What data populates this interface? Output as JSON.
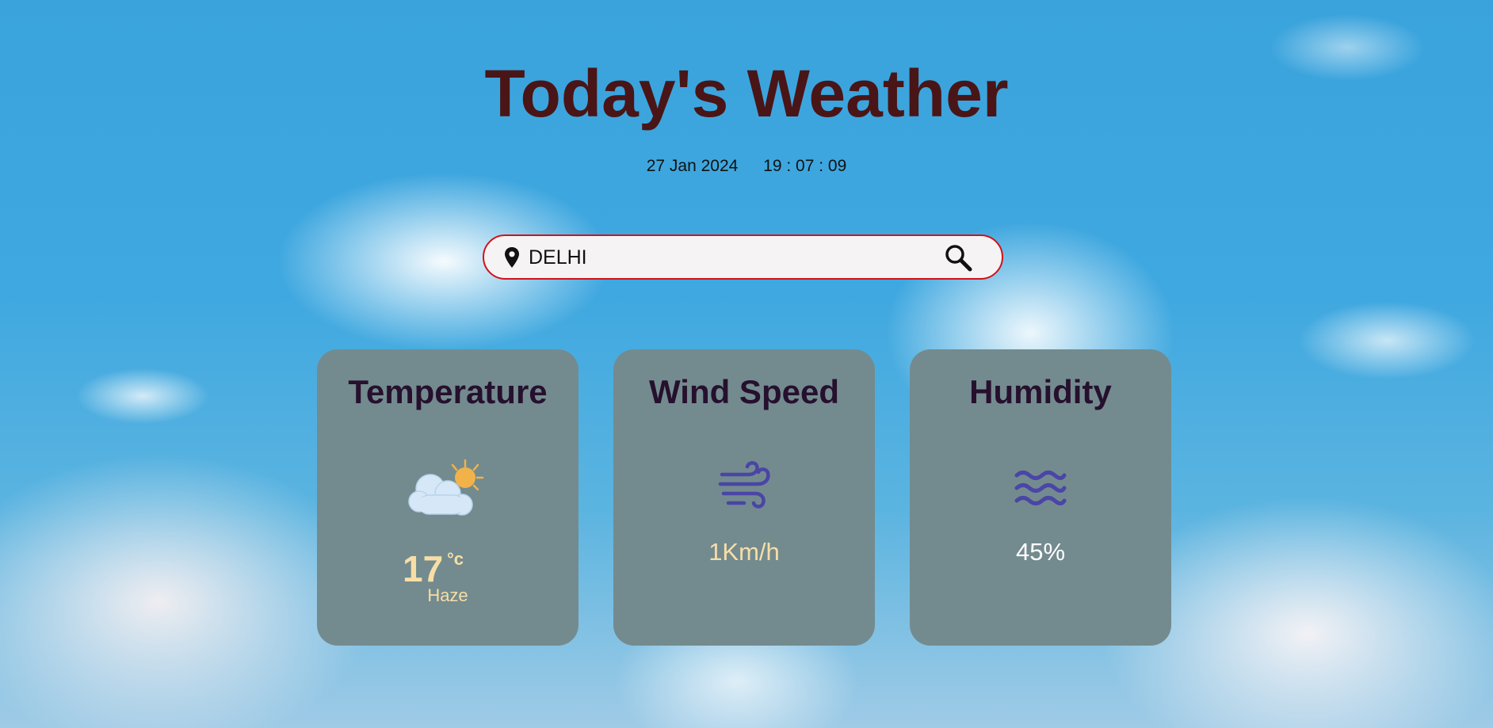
{
  "page": {
    "title": "Today's Weather",
    "date": "27 Jan 2024",
    "time": "19 : 07 : 09"
  },
  "search": {
    "value": "DELHI",
    "location_icon": "map-pin-icon",
    "search_icon": "magnifier-icon"
  },
  "cards": {
    "temperature": {
      "title": "Temperature",
      "icon": "partly-cloudy-icon",
      "value": "17",
      "unit": "°c",
      "condition": "Haze"
    },
    "wind": {
      "title": "Wind Speed",
      "icon": "wind-icon",
      "value": "1Km/h"
    },
    "humidity": {
      "title": "Humidity",
      "icon": "water-waves-icon",
      "value": "45%"
    }
  },
  "colors": {
    "title": "#4a1517",
    "card_bg": "#738b8f",
    "card_title": "#26102e",
    "accent_value": "#f7dea7",
    "icon_blue": "#4a45a6",
    "search_border": "#d0131a"
  }
}
